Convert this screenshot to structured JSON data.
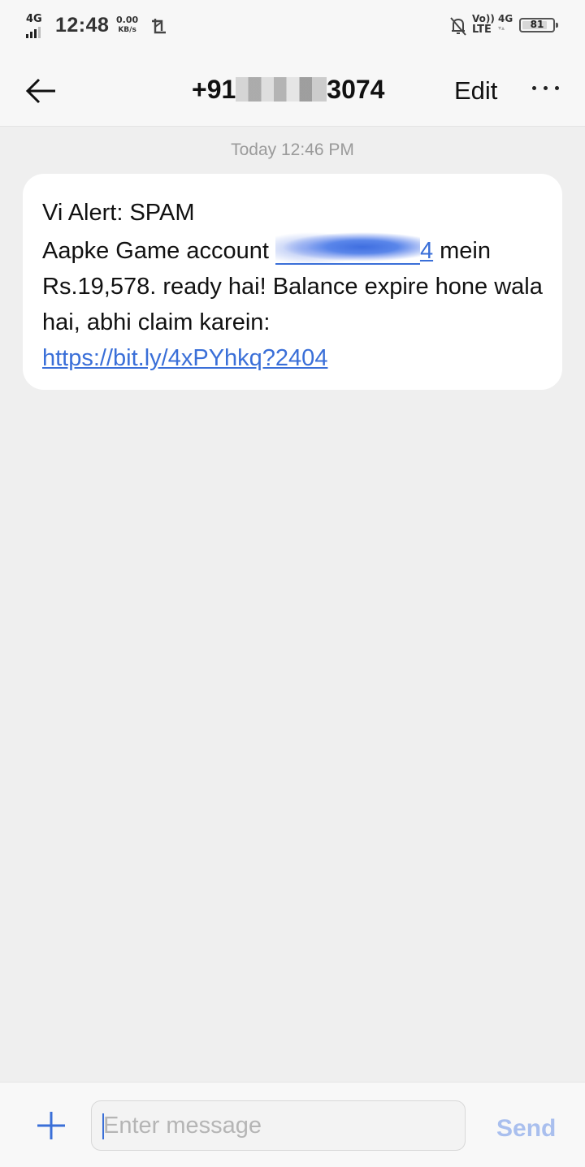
{
  "status_bar": {
    "network_label": "4G",
    "time": "12:48",
    "speed_value": "0.00",
    "speed_unit": "KB/s",
    "volte_top": "Vo))",
    "volte_bottom": "LTE",
    "second_network": "4G",
    "battery_level": "81",
    "battery_fraction": 0.81
  },
  "header": {
    "contact_prefix": "+91",
    "contact_suffix": "3074",
    "edit_label": "Edit"
  },
  "conversation": {
    "timestamp": "Today 12:46 PM",
    "message": {
      "line1": "Vi Alert: SPAM",
      "text_before_redaction": "Aapke Game account ",
      "redacted_tail": "4",
      "text_after_redaction": " mein Rs.19,578. ready hai! Balance expire hone wala hai, abhi claim karein:",
      "link": "https://bit.ly/4xPYhkq?2404"
    }
  },
  "composer": {
    "placeholder": "Enter message",
    "send_label": "Send"
  },
  "colors": {
    "link": "#3a6fd8",
    "send_disabled": "#a9bfee",
    "background": "#efefef",
    "bubble": "#ffffff"
  },
  "icons": [
    "back-arrow-icon",
    "more-options-icon",
    "plus-icon",
    "signal-icon",
    "screenshot-icon",
    "notifications-off-icon",
    "battery-icon"
  ]
}
